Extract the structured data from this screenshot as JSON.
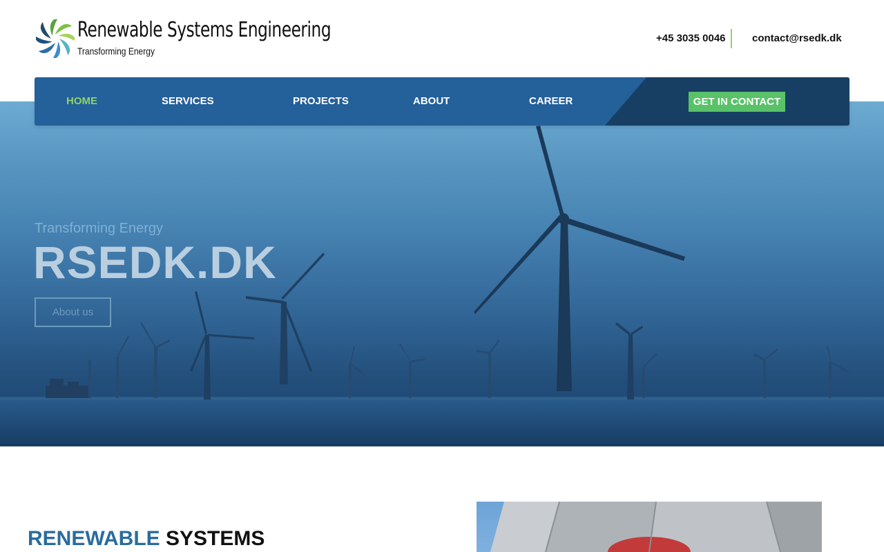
{
  "header": {
    "logo_title": "Renewable Systems Engineering",
    "logo_subtitle": "Transforming Energy",
    "phone": "+45 3035 0046",
    "email": "contact@rsedk.dk"
  },
  "nav": {
    "items": [
      {
        "label": "HOME",
        "active": true
      },
      {
        "label": "SERVICES",
        "active": false
      },
      {
        "label": "PROJECTS",
        "active": false
      },
      {
        "label": "ABOUT",
        "active": false
      },
      {
        "label": "CAREER",
        "active": false
      }
    ],
    "cta_label": "GET IN CONTACT"
  },
  "hero": {
    "subtitle": "Transforming Energy",
    "title": "RSEDK.DK",
    "button_label": "About us"
  },
  "section": {
    "title_part1": "RENEWABLE",
    "title_part2": "SYSTEMS"
  },
  "colors": {
    "nav_bg": "#24609a",
    "nav_dark": "#173f63",
    "active_nav": "#8fd36b",
    "cta_bg": "#59c268",
    "heading_blue": "#2a6c9e"
  }
}
